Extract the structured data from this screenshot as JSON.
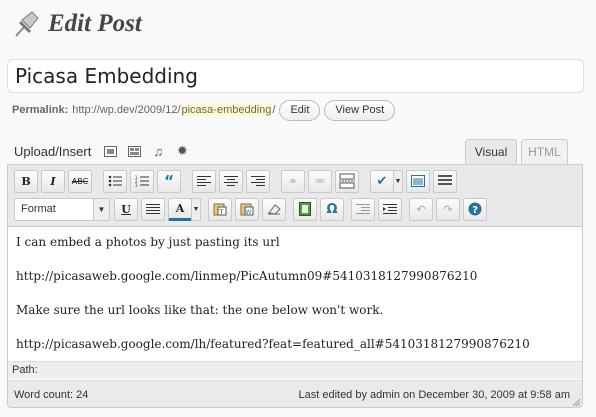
{
  "header": {
    "title": "Edit Post",
    "icon": "pushpin-icon"
  },
  "post": {
    "title": "Picasa Embedding"
  },
  "permalink": {
    "label": "Permalink:",
    "url_prefix": "http://wp.dev/2009/12/",
    "slug": "picasa-embedding",
    "url_suffix": "/",
    "edit_label": "Edit",
    "view_label": "View Post"
  },
  "media": {
    "label": "Upload/Insert",
    "icons": [
      "add-image-icon",
      "add-video-icon",
      "add-audio-icon",
      "add-media-icon"
    ]
  },
  "tabs": {
    "visual": "Visual",
    "html": "HTML",
    "active": "visual"
  },
  "toolbar": {
    "row1": [
      "bold",
      "italic",
      "strikethrough",
      "bullet-list",
      "numbered-list",
      "blockquote",
      "align-left",
      "align-center",
      "align-right",
      "link",
      "unlink",
      "insert-more",
      "spellcheck",
      "fullscreen",
      "kitchen-sink"
    ],
    "format_value": "Format",
    "row2": [
      "underline",
      "justify",
      "text-color",
      "paste-text",
      "paste-word",
      "remove-format",
      "insert-media",
      "special-character",
      "outdent",
      "indent",
      "undo",
      "redo",
      "help"
    ],
    "bold_glyph": "B",
    "italic_glyph": "I",
    "strike_glyph": "ABC",
    "underline_glyph": "U",
    "color_glyph": "A",
    "special_glyph": "Ω",
    "help_glyph": "?"
  },
  "content": {
    "paragraphs": [
      "I can embed a photos by just pasting its url",
      "http://picasaweb.google.com/linmep/PicAutumn09#5410318127990876210",
      "Make sure the url looks like that: the one below won't work.",
      "http://picasaweb.google.com/lh/featured?feat=featured_all#5410318127990876210"
    ]
  },
  "path_bar": {
    "label": "Path:"
  },
  "status": {
    "word_count": "Word count: 24",
    "last_edited": "Last edited by admin on December 30, 2009 at 9:58 am"
  },
  "colors": {
    "accent": "#21759b",
    "slug_highlight": "#fffbcc",
    "toolbar_bg": "#e9e9e9"
  }
}
